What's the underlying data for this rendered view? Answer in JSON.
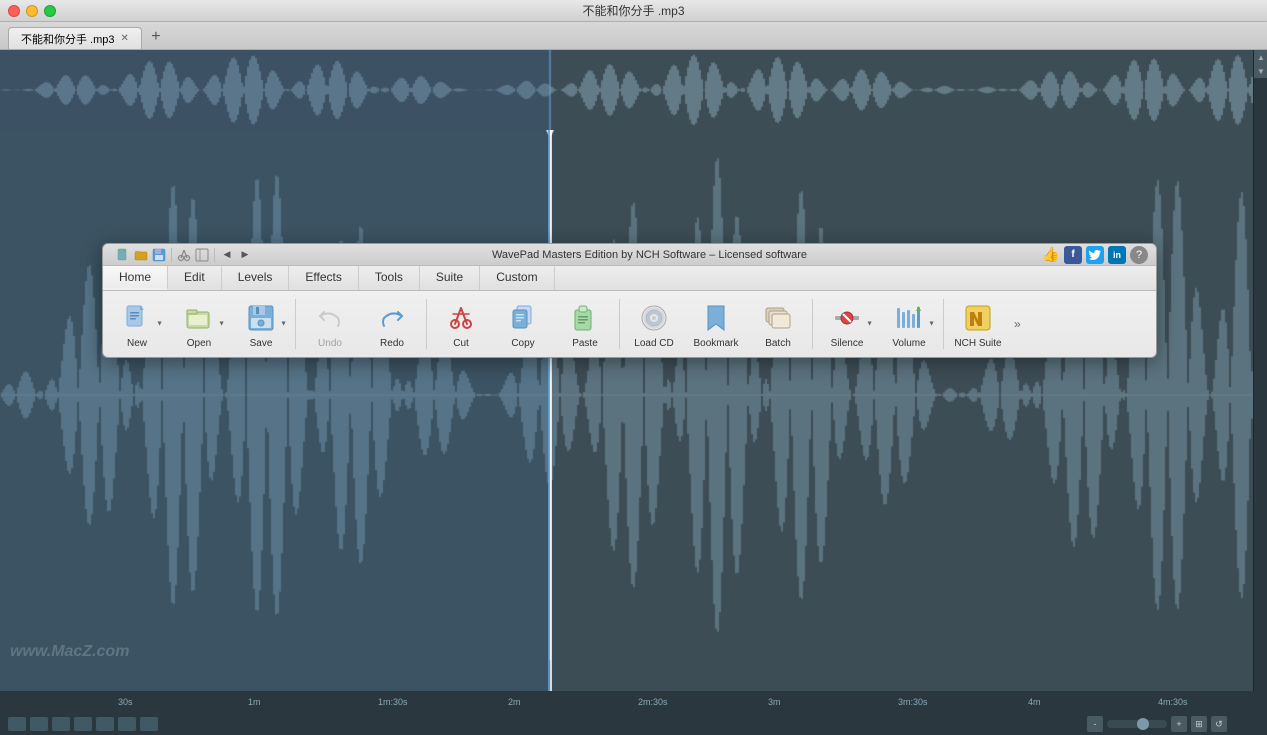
{
  "window": {
    "title": "不能和你分手 .mp3",
    "tab_label": "不能和你分手 .mp3"
  },
  "toolbar_dialog": {
    "title": "WavePad Masters Edition by NCH Software – Licensed software"
  },
  "nav_tabs": [
    {
      "id": "home",
      "label": "Home",
      "active": true
    },
    {
      "id": "edit",
      "label": "Edit",
      "active": false
    },
    {
      "id": "levels",
      "label": "Levels",
      "active": false
    },
    {
      "id": "effects",
      "label": "Effects",
      "active": false
    },
    {
      "id": "tools",
      "label": "Tools",
      "active": false
    },
    {
      "id": "suite",
      "label": "Suite",
      "active": false
    },
    {
      "id": "custom",
      "label": "Custom",
      "active": false
    }
  ],
  "toolbar_buttons": [
    {
      "id": "new",
      "label": "New",
      "icon": "new-icon",
      "has_arrow": true,
      "disabled": false
    },
    {
      "id": "open",
      "label": "Open",
      "icon": "open-icon",
      "has_arrow": true,
      "disabled": false
    },
    {
      "id": "save",
      "label": "Save",
      "icon": "save-icon",
      "has_arrow": true,
      "disabled": false
    },
    {
      "id": "undo",
      "label": "Undo",
      "icon": "undo-icon",
      "has_arrow": false,
      "disabled": true
    },
    {
      "id": "redo",
      "label": "Redo",
      "icon": "redo-icon",
      "has_arrow": false,
      "disabled": false
    },
    {
      "id": "cut",
      "label": "Cut",
      "icon": "cut-icon",
      "has_arrow": false,
      "disabled": false
    },
    {
      "id": "copy",
      "label": "Copy",
      "icon": "copy-icon",
      "has_arrow": false,
      "disabled": false
    },
    {
      "id": "paste",
      "label": "Paste",
      "icon": "paste-icon",
      "has_arrow": false,
      "disabled": false
    },
    {
      "id": "load_cd",
      "label": "Load CD",
      "icon": "cd-icon",
      "has_arrow": false,
      "disabled": false
    },
    {
      "id": "bookmark",
      "label": "Bookmark",
      "icon": "bookmark-icon",
      "has_arrow": false,
      "disabled": false
    },
    {
      "id": "batch",
      "label": "Batch",
      "icon": "batch-icon",
      "has_arrow": false,
      "disabled": false
    },
    {
      "id": "silence",
      "label": "Silence",
      "icon": "silence-icon",
      "has_arrow": true,
      "disabled": false
    },
    {
      "id": "volume",
      "label": "Volume",
      "icon": "volume-icon",
      "has_arrow": true,
      "disabled": false
    },
    {
      "id": "nch_suite",
      "label": "NCH Suite",
      "icon": "nch-icon",
      "has_arrow": false,
      "disabled": false
    }
  ],
  "timeline": {
    "markers": [
      "30s",
      "1m",
      "1m:30s",
      "2m",
      "2m:30s",
      "3m",
      "3m:30s",
      "4m",
      "4m:30s"
    ]
  },
  "watermark": "www.MacZ.com",
  "social": {
    "thumbs": "👍",
    "facebook": "f",
    "twitter": "t",
    "linkedin": "in"
  },
  "status_bar": {
    "zoom_in": "+",
    "zoom_out": "-"
  }
}
